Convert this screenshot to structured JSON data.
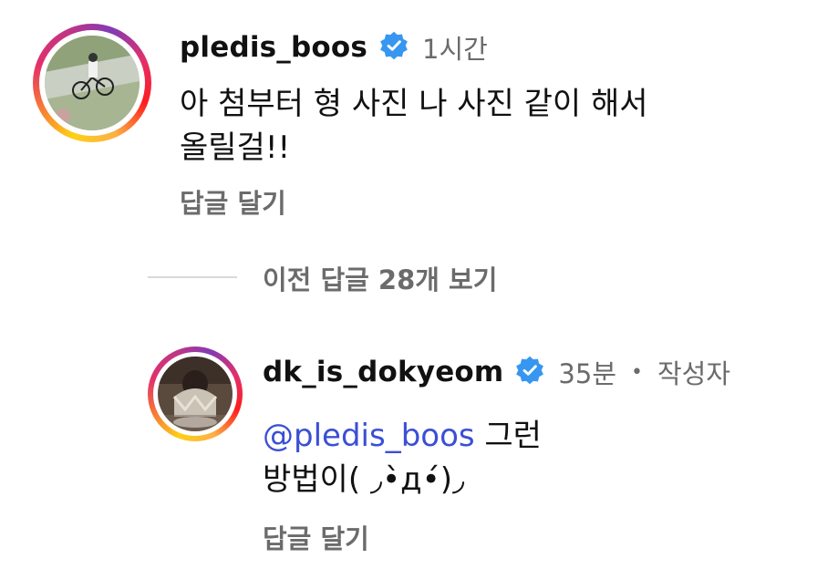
{
  "comment1": {
    "username": "pledis_boos",
    "time": "1시간",
    "text_line1": "아 첨부터 형 사진 나 사진 같이 해서",
    "text_line2": "올릴걸!!",
    "reply_label": "답글 달기"
  },
  "thread": {
    "view_previous_label": "이전 답글 28개 보기"
  },
  "comment2": {
    "username": "dk_is_dokyeom",
    "time": "35분",
    "separator": "•",
    "author_badge": "작성자",
    "mention": "@pledis_boos",
    "text_line1_rest": " 그런",
    "text_line2": "방법이( ◞•̀д•́)◞",
    "reply_label": "답글 달기"
  },
  "colors": {
    "verified_blue": "#3797f0",
    "mention_blue": "#3b4fd6",
    "secondary_text": "#6b6b6b"
  }
}
